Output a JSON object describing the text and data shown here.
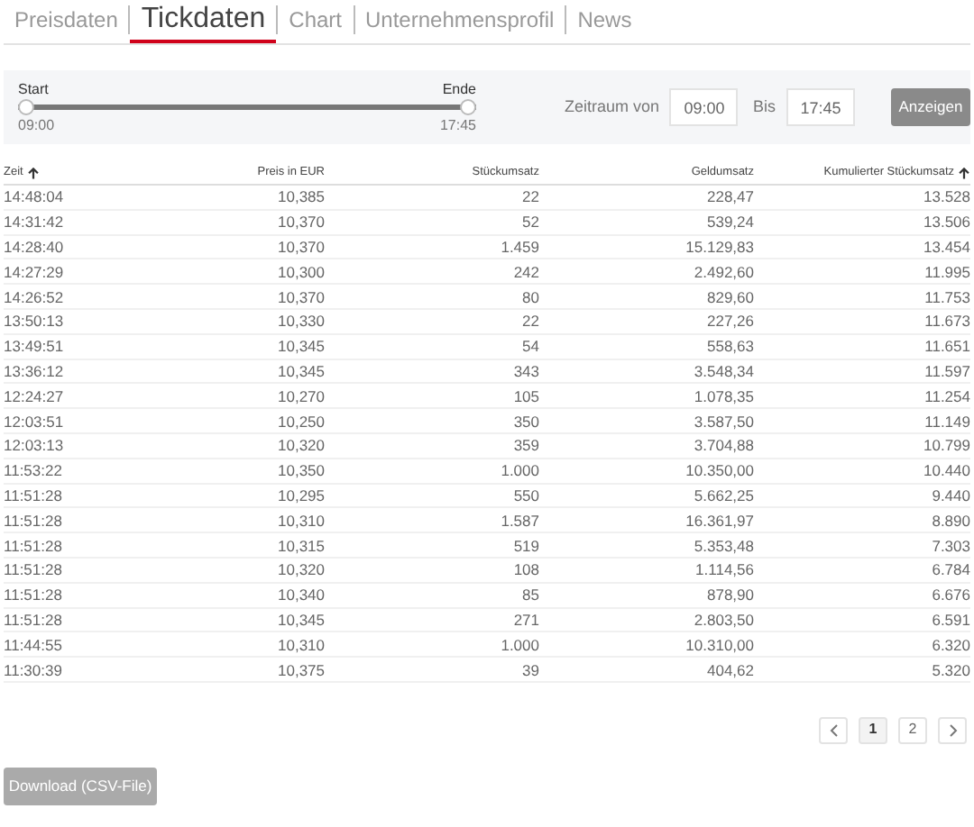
{
  "tabs": [
    {
      "label": "Preisdaten",
      "selected": false
    },
    {
      "label": "Tickdaten",
      "selected": true
    },
    {
      "label": "Chart",
      "selected": false
    },
    {
      "label": "Unternehmensprofil",
      "selected": false
    },
    {
      "label": "News",
      "selected": false
    }
  ],
  "filter": {
    "slider": {
      "handles": [
        {
          "label": "Start",
          "time": "09:00",
          "level": 0
        },
        {
          "label": "Ende",
          "time": "17:45",
          "level": 1
        }
      ]
    },
    "from_label": "Zeitraum von",
    "from_value": "09:00",
    "to_label": "Bis",
    "to_value": "17:45",
    "button": "Anzeigen"
  },
  "table": {
    "columns": [
      {
        "label": "Zeit",
        "sorted": true
      },
      {
        "label": "Preis in EUR",
        "sorted": false
      },
      {
        "label": "Stückumsatz",
        "sorted": false
      },
      {
        "label": "Geldumsatz",
        "sorted": false
      },
      {
        "label": "Kumulierter Stückumsatz",
        "sorted": true
      }
    ],
    "rows": [
      [
        "14:48:04",
        "10,385",
        "22",
        "228,47",
        "13.528"
      ],
      [
        "14:31:42",
        "10,370",
        "52",
        "539,24",
        "13.506"
      ],
      [
        "14:28:40",
        "10,370",
        "1.459",
        "15.129,83",
        "13.454"
      ],
      [
        "14:27:29",
        "10,300",
        "242",
        "2.492,60",
        "11.995"
      ],
      [
        "14:26:52",
        "10,370",
        "80",
        "829,60",
        "11.753"
      ],
      [
        "13:50:13",
        "10,330",
        "22",
        "227,26",
        "11.673"
      ],
      [
        "13:49:51",
        "10,345",
        "54",
        "558,63",
        "11.651"
      ],
      [
        "13:36:12",
        "10,345",
        "343",
        "3.548,34",
        "11.597"
      ],
      [
        "12:24:27",
        "10,270",
        "105",
        "1.078,35",
        "11.254"
      ],
      [
        "12:03:51",
        "10,250",
        "350",
        "3.587,50",
        "11.149"
      ],
      [
        "12:03:13",
        "10,320",
        "359",
        "3.704,88",
        "10.799"
      ],
      [
        "11:53:22",
        "10,350",
        "1.000",
        "10.350,00",
        "10.440"
      ],
      [
        "11:51:28",
        "10,295",
        "550",
        "5.662,25",
        "9.440"
      ],
      [
        "11:51:28",
        "10,310",
        "1.587",
        "16.361,97",
        "8.890"
      ],
      [
        "11:51:28",
        "10,315",
        "519",
        "5.353,48",
        "7.303"
      ],
      [
        "11:51:28",
        "10,320",
        "108",
        "1.114,56",
        "6.784"
      ],
      [
        "11:51:28",
        "10,340",
        "85",
        "878,90",
        "6.676"
      ],
      [
        "11:51:28",
        "10,345",
        "271",
        "2.803,50",
        "6.591"
      ],
      [
        "11:44:55",
        "10,310",
        "1.000",
        "10.310,00",
        "6.320"
      ],
      [
        "11:30:39",
        "10,375",
        "39",
        "404,62",
        "5.320"
      ]
    ]
  },
  "pagination": {
    "pages": [
      {
        "label": "1",
        "selected": true
      },
      {
        "label": "2",
        "selected": false
      }
    ]
  },
  "download_button": "Download (CSV-File)"
}
